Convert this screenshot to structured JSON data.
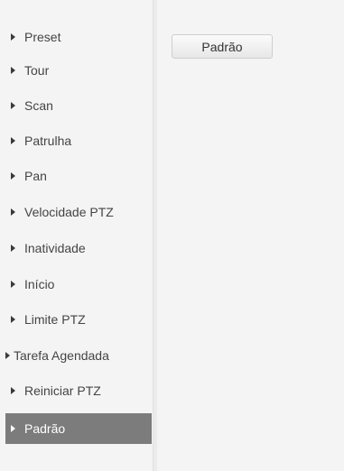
{
  "sidebar": {
    "items": [
      {
        "label": "Preset"
      },
      {
        "label": "Tour"
      },
      {
        "label": "Scan"
      },
      {
        "label": "Patrulha"
      },
      {
        "label": "Pan"
      },
      {
        "label": "Velocidade PTZ"
      },
      {
        "label": "Inatividade"
      },
      {
        "label": "Início"
      },
      {
        "label": "Limite PTZ"
      },
      {
        "label": "Tarefa Agendada"
      },
      {
        "label": "Reiniciar PTZ"
      },
      {
        "label": "Padrão",
        "active": true
      }
    ]
  },
  "main": {
    "default_button_label": "Padrão"
  },
  "colors": {
    "active_item_bg": "#7c7c7c",
    "page_bg": "#f4f4f4"
  },
  "icons": {
    "item_marker": "triangle-right-icon"
  }
}
